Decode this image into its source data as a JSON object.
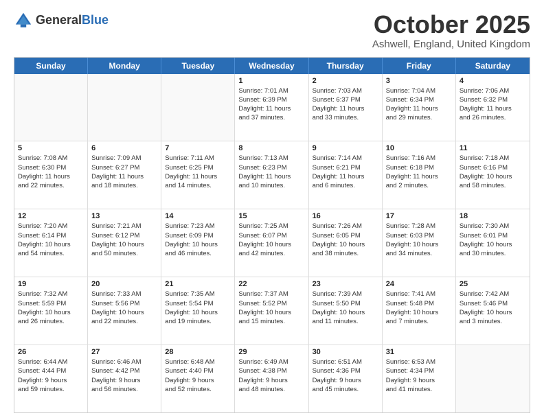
{
  "header": {
    "logo_line1": "General",
    "logo_line2": "Blue",
    "month": "October 2025",
    "location": "Ashwell, England, United Kingdom"
  },
  "days_of_week": [
    "Sunday",
    "Monday",
    "Tuesday",
    "Wednesday",
    "Thursday",
    "Friday",
    "Saturday"
  ],
  "weeks": [
    [
      {
        "day": "",
        "info": ""
      },
      {
        "day": "",
        "info": ""
      },
      {
        "day": "",
        "info": ""
      },
      {
        "day": "1",
        "info": "Sunrise: 7:01 AM\nSunset: 6:39 PM\nDaylight: 11 hours\nand 37 minutes."
      },
      {
        "day": "2",
        "info": "Sunrise: 7:03 AM\nSunset: 6:37 PM\nDaylight: 11 hours\nand 33 minutes."
      },
      {
        "day": "3",
        "info": "Sunrise: 7:04 AM\nSunset: 6:34 PM\nDaylight: 11 hours\nand 29 minutes."
      },
      {
        "day": "4",
        "info": "Sunrise: 7:06 AM\nSunset: 6:32 PM\nDaylight: 11 hours\nand 26 minutes."
      }
    ],
    [
      {
        "day": "5",
        "info": "Sunrise: 7:08 AM\nSunset: 6:30 PM\nDaylight: 11 hours\nand 22 minutes."
      },
      {
        "day": "6",
        "info": "Sunrise: 7:09 AM\nSunset: 6:27 PM\nDaylight: 11 hours\nand 18 minutes."
      },
      {
        "day": "7",
        "info": "Sunrise: 7:11 AM\nSunset: 6:25 PM\nDaylight: 11 hours\nand 14 minutes."
      },
      {
        "day": "8",
        "info": "Sunrise: 7:13 AM\nSunset: 6:23 PM\nDaylight: 11 hours\nand 10 minutes."
      },
      {
        "day": "9",
        "info": "Sunrise: 7:14 AM\nSunset: 6:21 PM\nDaylight: 11 hours\nand 6 minutes."
      },
      {
        "day": "10",
        "info": "Sunrise: 7:16 AM\nSunset: 6:18 PM\nDaylight: 11 hours\nand 2 minutes."
      },
      {
        "day": "11",
        "info": "Sunrise: 7:18 AM\nSunset: 6:16 PM\nDaylight: 10 hours\nand 58 minutes."
      }
    ],
    [
      {
        "day": "12",
        "info": "Sunrise: 7:20 AM\nSunset: 6:14 PM\nDaylight: 10 hours\nand 54 minutes."
      },
      {
        "day": "13",
        "info": "Sunrise: 7:21 AM\nSunset: 6:12 PM\nDaylight: 10 hours\nand 50 minutes."
      },
      {
        "day": "14",
        "info": "Sunrise: 7:23 AM\nSunset: 6:09 PM\nDaylight: 10 hours\nand 46 minutes."
      },
      {
        "day": "15",
        "info": "Sunrise: 7:25 AM\nSunset: 6:07 PM\nDaylight: 10 hours\nand 42 minutes."
      },
      {
        "day": "16",
        "info": "Sunrise: 7:26 AM\nSunset: 6:05 PM\nDaylight: 10 hours\nand 38 minutes."
      },
      {
        "day": "17",
        "info": "Sunrise: 7:28 AM\nSunset: 6:03 PM\nDaylight: 10 hours\nand 34 minutes."
      },
      {
        "day": "18",
        "info": "Sunrise: 7:30 AM\nSunset: 6:01 PM\nDaylight: 10 hours\nand 30 minutes."
      }
    ],
    [
      {
        "day": "19",
        "info": "Sunrise: 7:32 AM\nSunset: 5:59 PM\nDaylight: 10 hours\nand 26 minutes."
      },
      {
        "day": "20",
        "info": "Sunrise: 7:33 AM\nSunset: 5:56 PM\nDaylight: 10 hours\nand 22 minutes."
      },
      {
        "day": "21",
        "info": "Sunrise: 7:35 AM\nSunset: 5:54 PM\nDaylight: 10 hours\nand 19 minutes."
      },
      {
        "day": "22",
        "info": "Sunrise: 7:37 AM\nSunset: 5:52 PM\nDaylight: 10 hours\nand 15 minutes."
      },
      {
        "day": "23",
        "info": "Sunrise: 7:39 AM\nSunset: 5:50 PM\nDaylight: 10 hours\nand 11 minutes."
      },
      {
        "day": "24",
        "info": "Sunrise: 7:41 AM\nSunset: 5:48 PM\nDaylight: 10 hours\nand 7 minutes."
      },
      {
        "day": "25",
        "info": "Sunrise: 7:42 AM\nSunset: 5:46 PM\nDaylight: 10 hours\nand 3 minutes."
      }
    ],
    [
      {
        "day": "26",
        "info": "Sunrise: 6:44 AM\nSunset: 4:44 PM\nDaylight: 9 hours\nand 59 minutes."
      },
      {
        "day": "27",
        "info": "Sunrise: 6:46 AM\nSunset: 4:42 PM\nDaylight: 9 hours\nand 56 minutes."
      },
      {
        "day": "28",
        "info": "Sunrise: 6:48 AM\nSunset: 4:40 PM\nDaylight: 9 hours\nand 52 minutes."
      },
      {
        "day": "29",
        "info": "Sunrise: 6:49 AM\nSunset: 4:38 PM\nDaylight: 9 hours\nand 48 minutes."
      },
      {
        "day": "30",
        "info": "Sunrise: 6:51 AM\nSunset: 4:36 PM\nDaylight: 9 hours\nand 45 minutes."
      },
      {
        "day": "31",
        "info": "Sunrise: 6:53 AM\nSunset: 4:34 PM\nDaylight: 9 hours\nand 41 minutes."
      },
      {
        "day": "",
        "info": ""
      }
    ]
  ]
}
